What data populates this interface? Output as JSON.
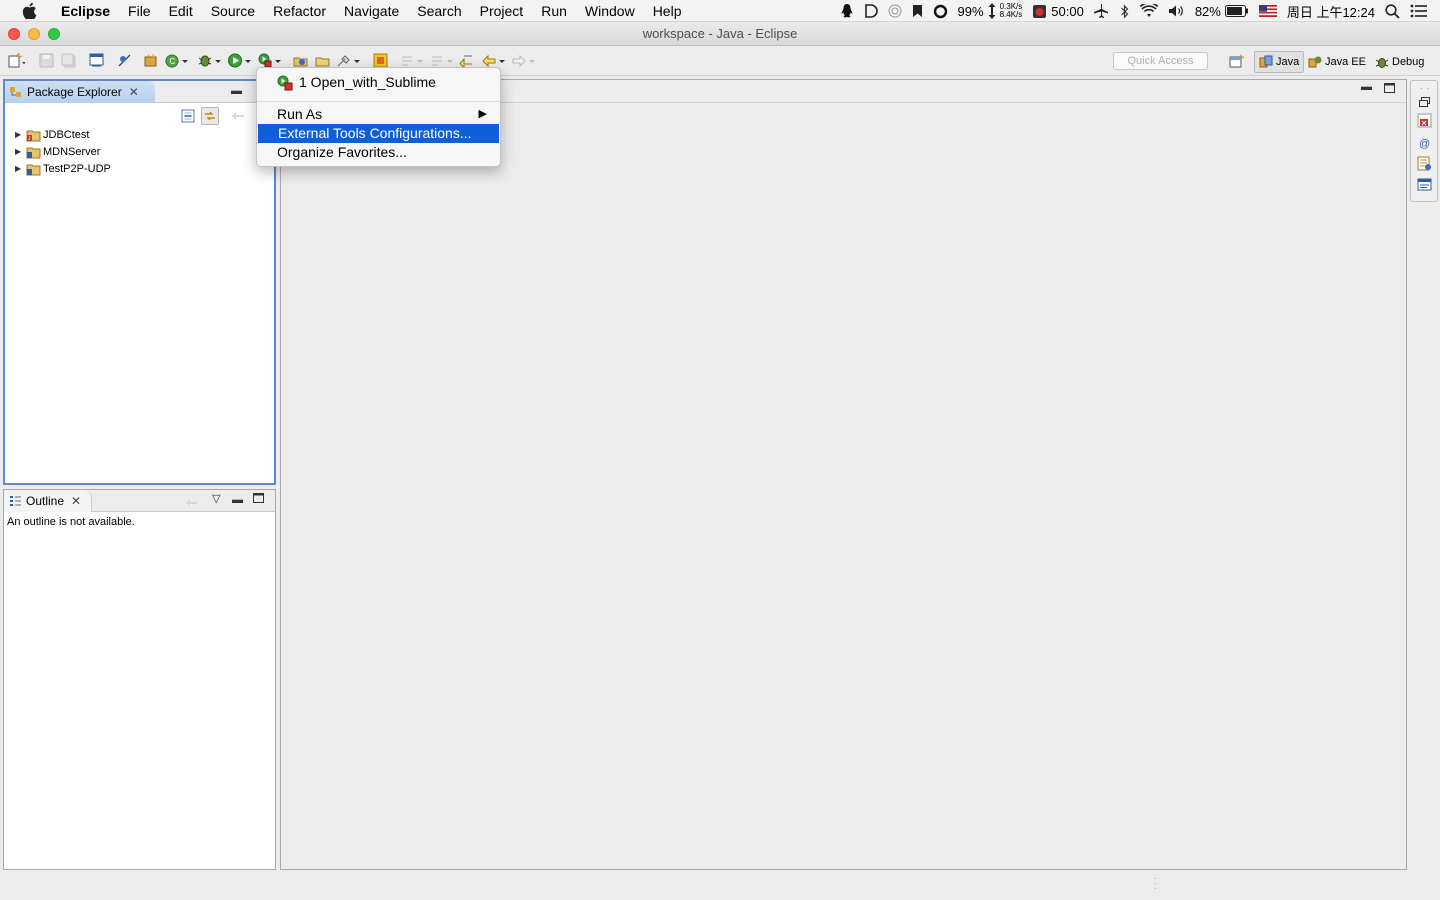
{
  "menubar": {
    "app_name": "Eclipse",
    "items": [
      "File",
      "Edit",
      "Source",
      "Refactor",
      "Navigate",
      "Search",
      "Project",
      "Run",
      "Window",
      "Help"
    ],
    "status": {
      "battery_small": "99%",
      "net_up": "0.3K/s",
      "net_down": "8.4K/s",
      "timer": "50:00",
      "battery": "82%",
      "datetime": "周日 上午12:24"
    }
  },
  "window": {
    "title": "workspace - Java - Eclipse"
  },
  "toolbar": {
    "quick_access_placeholder": "Quick Access",
    "perspectives": [
      "Java",
      "Java EE",
      "Debug"
    ]
  },
  "package_explorer": {
    "title": "Package Explorer",
    "projects": [
      "JDBCtest",
      "MDNServer",
      "TestP2P-UDP"
    ]
  },
  "outline": {
    "title": "Outline",
    "message": "An outline is not available."
  },
  "context_menu": {
    "items": [
      {
        "label": "1 Open_with_Sublime"
      },
      {
        "label": "Run As"
      },
      {
        "label": "External Tools Configurations..."
      },
      {
        "label": "Organize Favorites..."
      }
    ],
    "highlight_color": "#0f5fd6"
  }
}
